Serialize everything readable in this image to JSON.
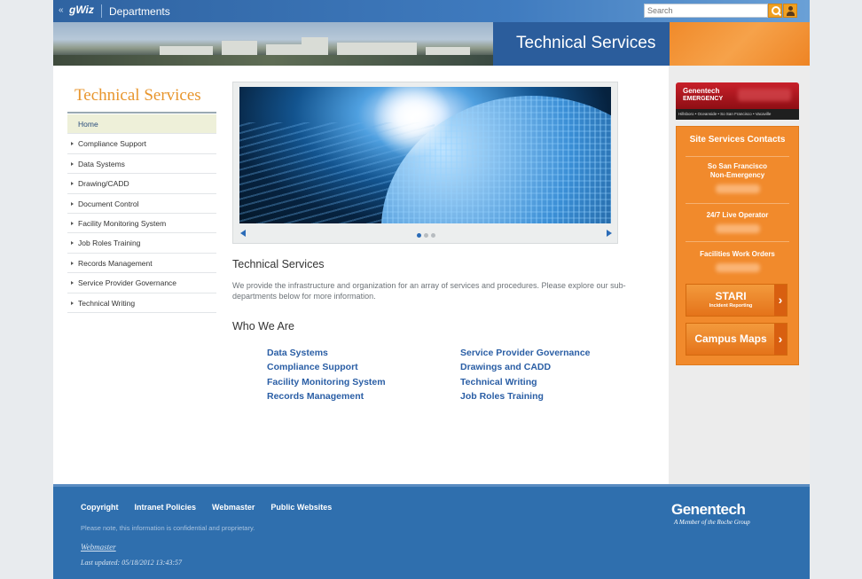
{
  "topbar": {
    "back": "«",
    "logo": "gWiz",
    "logo_prefix": "g",
    "departments": "Departments",
    "search_placeholder": "Search"
  },
  "banner": {
    "title": "Technical Services"
  },
  "sidebar": {
    "title": "Technical Services",
    "items": [
      {
        "label": "Home"
      },
      {
        "label": "Compliance Support"
      },
      {
        "label": "Data Systems"
      },
      {
        "label": "Drawing/CADD"
      },
      {
        "label": "Document Control"
      },
      {
        "label": "Facility Monitoring System"
      },
      {
        "label": "Job Roles Training"
      },
      {
        "label": "Records Management"
      },
      {
        "label": "Service Provider Governance"
      },
      {
        "label": "Technical Writing"
      }
    ]
  },
  "slider": {
    "slide_count": 3,
    "active_slide": 1
  },
  "main": {
    "heading": "Technical Services",
    "intro": "We provide the infrastructure and organization for an array of services and procedures. Please explore our sub-departments below for more information.",
    "who_heading": "Who We Are",
    "links_left": [
      "Data Systems",
      "Compliance Support",
      "Facility Monitoring System",
      "Records Management"
    ],
    "links_right": [
      "Service Provider Governance",
      "Drawings and CADD",
      "Technical Writing",
      "Job Roles Training"
    ]
  },
  "right": {
    "emergency_line1": "Genentech",
    "emergency_line2": "EMERGENCY",
    "emergency_sites": "Hillsboro • Oceanside • So San Francisco • Vacaville",
    "contacts_title": "Site Services Contacts",
    "contact1_label": "So San Francisco Non-Emergency",
    "contact2_label": "24/7 Live Operator",
    "contact3_label": "Facilities Work Orders",
    "stari_label": "STARI",
    "stari_sub": "Incident Reporting",
    "maps_label": "Campus Maps"
  },
  "footer": {
    "links": [
      "Copyright",
      "Intranet Policies",
      "Webmaster",
      "Public Websites"
    ],
    "note": "Please note, this information is confidential and proprietary.",
    "webmaster": "Webmaster",
    "updated": "Last updated: 05/18/2012 13:43:57",
    "brand": "Genentech",
    "brand_sub": "A Member of the Roche Group"
  },
  "colors": {
    "topbar_blue": "#2f63a1",
    "title_blue": "#2b5d9c",
    "accent_orange": "#f18a2c",
    "sidebar_title": "#e8962e",
    "link_blue": "#2a5ea5",
    "footer_blue": "#2f6fae",
    "emergency_red": "#c8202a"
  },
  "icons": [
    "back-arrow-icon",
    "search-icon",
    "user-icon",
    "prev-arrow-icon",
    "next-arrow-icon",
    "chevron-right-icon"
  ]
}
